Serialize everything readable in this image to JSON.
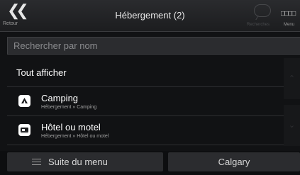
{
  "header": {
    "back_label": "Retour",
    "title": "Hébergement (2)",
    "history_label": "Recherches",
    "menu_label": "Menu"
  },
  "search": {
    "placeholder": "Rechercher par nom"
  },
  "list": {
    "show_all": "Tout afficher",
    "items": [
      {
        "name": "Camping",
        "path": "Hébergement » Camping",
        "icon": "camping-icon"
      },
      {
        "name": "Hôtel ou motel",
        "path": "Hébergement » Hôtel ou motel",
        "icon": "hotel-icon"
      }
    ]
  },
  "footer": {
    "more_label": "Suite du menu",
    "city_label": "Calgary"
  },
  "colors": {
    "background": "#111214",
    "button": "#2b2c2f",
    "text": "#ffffff"
  }
}
